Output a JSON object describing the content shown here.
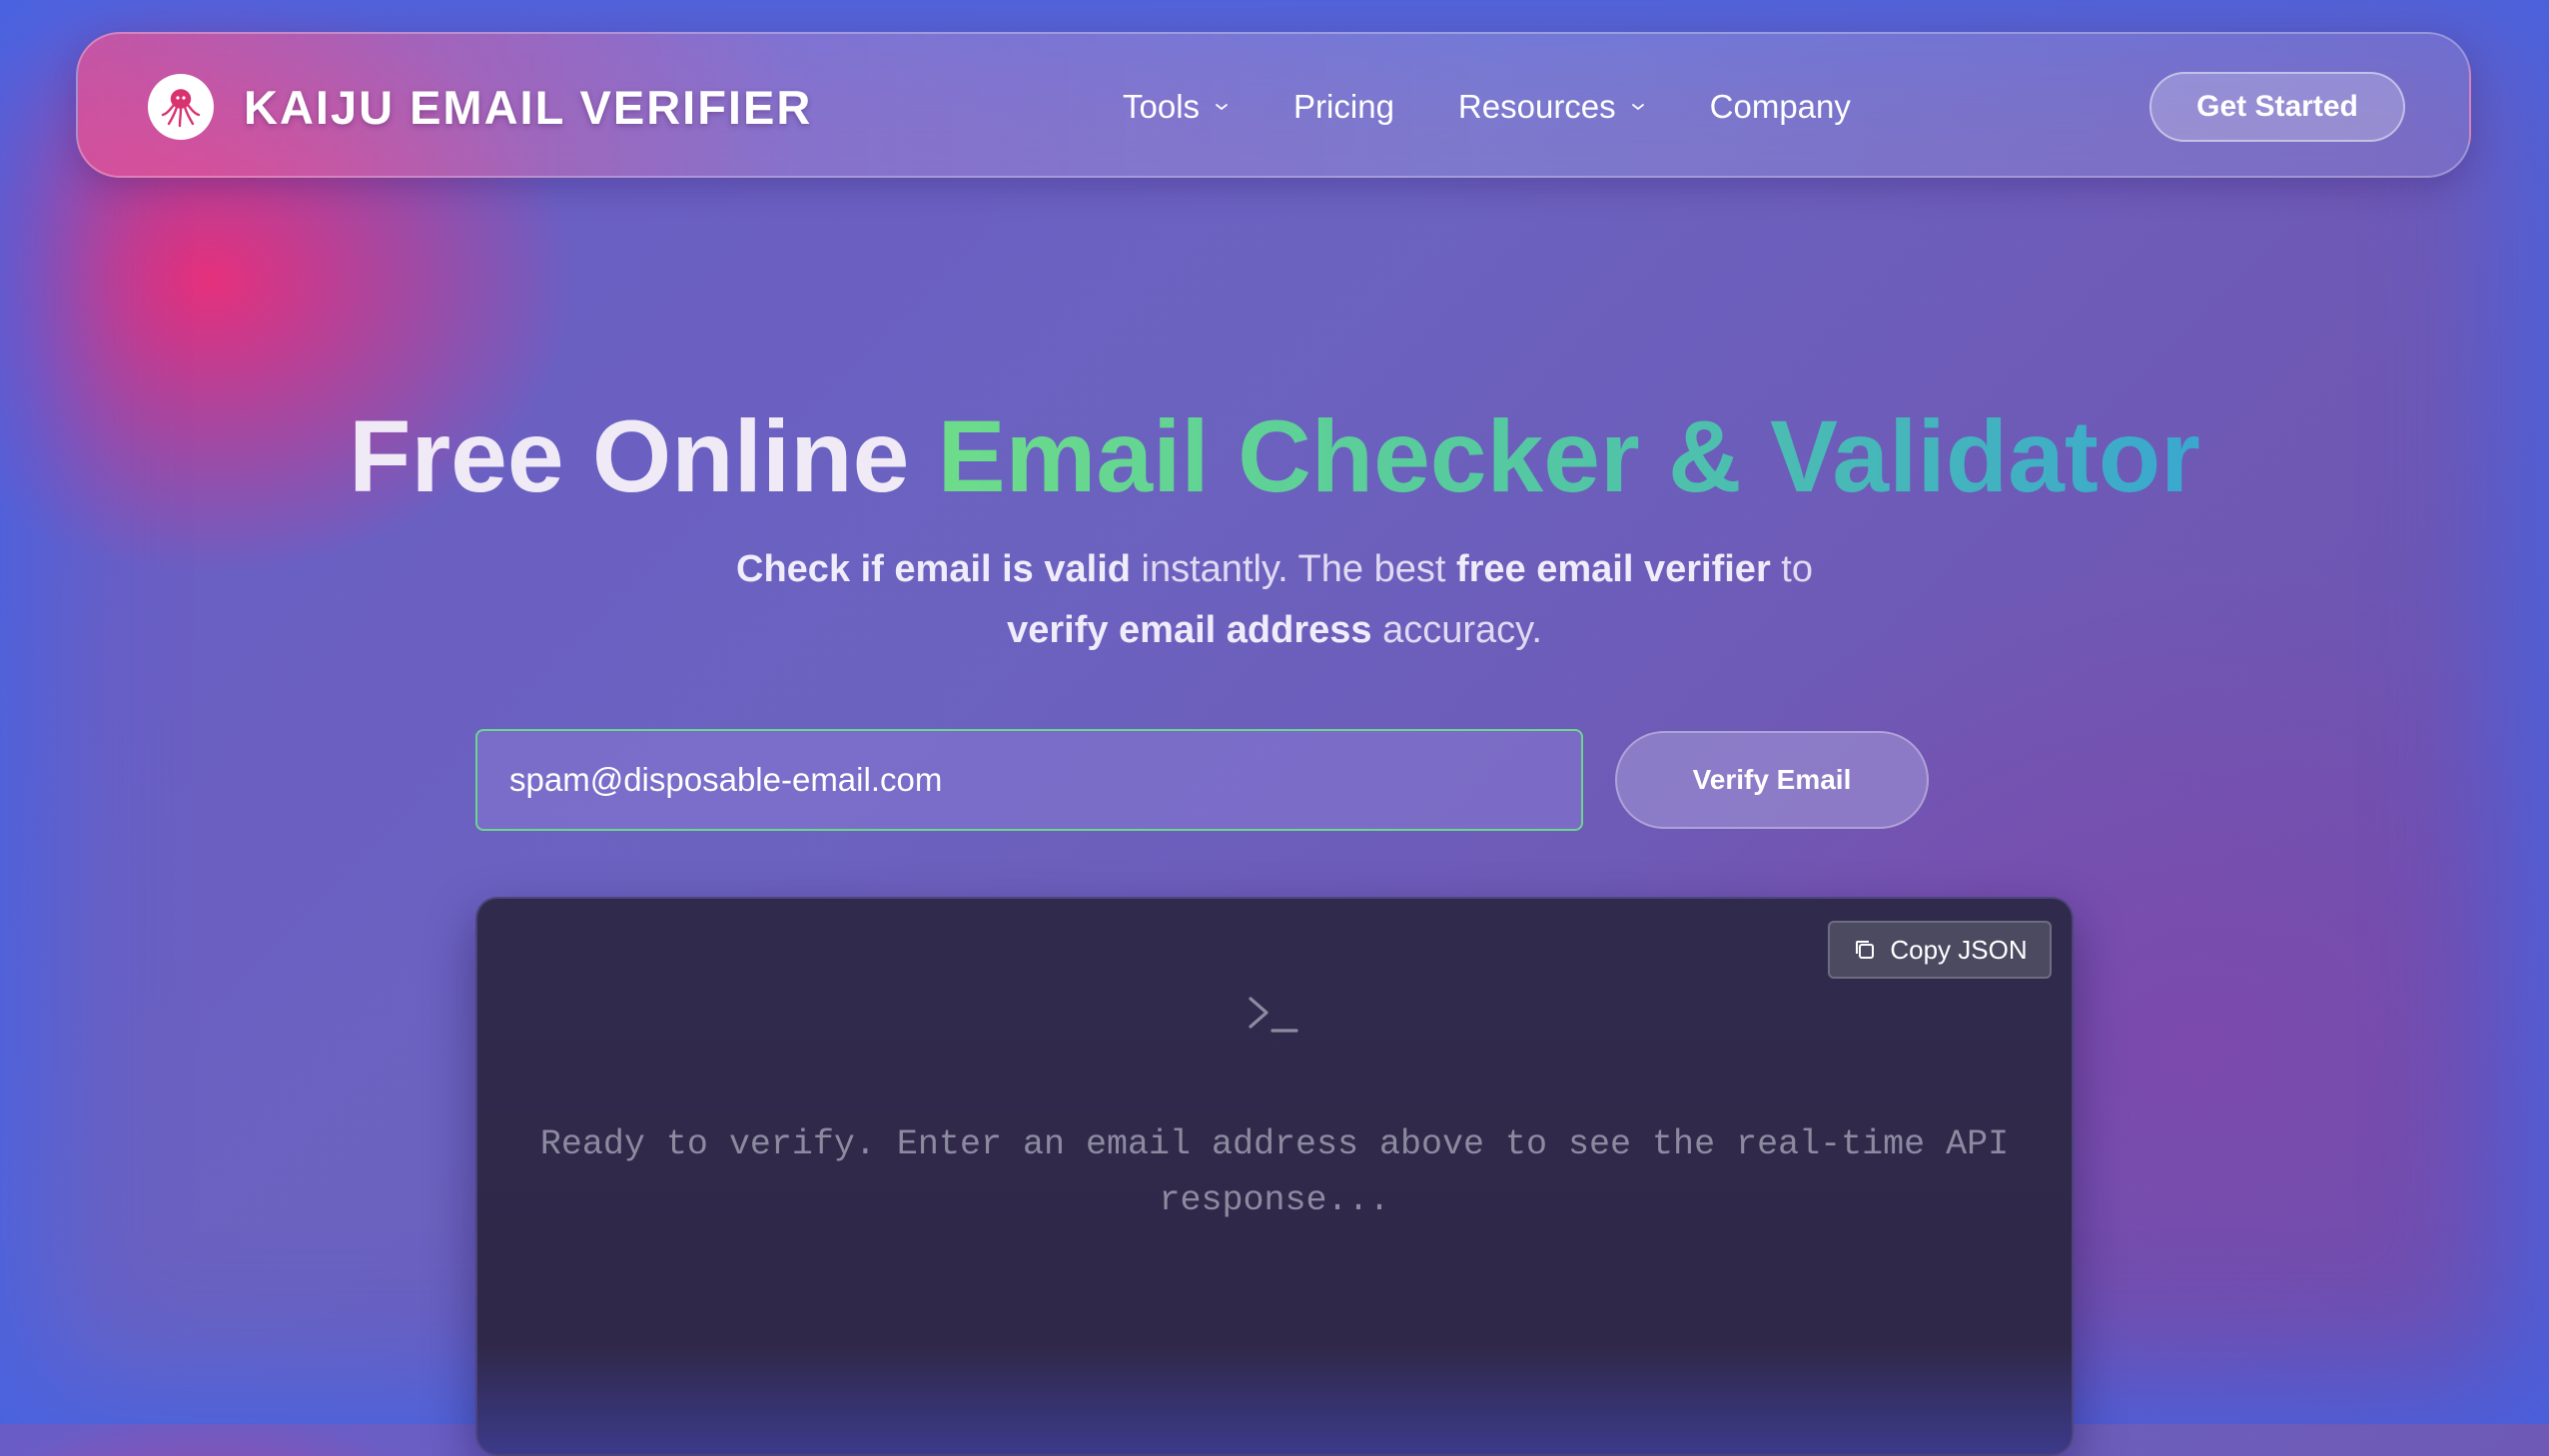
{
  "nav": {
    "brand_name": "KAIJU EMAIL VERIFIER",
    "logo_icon": "octopus-icon",
    "links": [
      {
        "label": "Tools",
        "has_dropdown": true
      },
      {
        "label": "Pricing",
        "has_dropdown": false
      },
      {
        "label": "Resources",
        "has_dropdown": true
      },
      {
        "label": "Company",
        "has_dropdown": false
      }
    ],
    "cta_label": "Get Started"
  },
  "hero": {
    "title_plain": "Free Online ",
    "title_highlight": "Email Checker & Validator",
    "subtitle": {
      "part1_bold": "Check if email is valid",
      "part2": " instantly. The best ",
      "part3_bold": "free email verifier",
      "part4": " to ",
      "part5_bold": "verify email address",
      "part6": " accuracy."
    }
  },
  "form": {
    "email_value": "spam@disposable-email.com",
    "submit_label": "Verify Email"
  },
  "console": {
    "copy_label": "Copy JSON",
    "prompt_icon": "terminal-prompt-icon",
    "message": "Ready to verify. Enter an email address above to see the real-time API response..."
  },
  "colors": {
    "accent_green": "#6ddc8a",
    "accent_teal": "#3aa8cf",
    "brand_pink": "#e8528f",
    "console_bg": "#2f2848"
  }
}
